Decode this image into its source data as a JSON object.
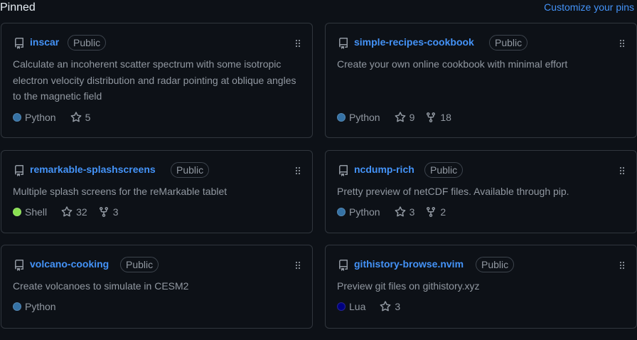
{
  "header": {
    "title": "Pinned",
    "customize_label": "Customize your pins"
  },
  "colors": {
    "python": "#3572A5",
    "shell": "#89e051",
    "lua": "#000080"
  },
  "cards": [
    {
      "name": "inscar",
      "visibility": "Public",
      "description": "Calculate an incoherent scatter spectrum with some isotropic electron velocity distribution and radar pointing at oblique angles to the magnetic field",
      "language": "Python",
      "stars": "5",
      "forks": ""
    },
    {
      "name": "simple-recipes-cookbook",
      "visibility": "Public",
      "description": "Create your own online cookbook with minimal effort",
      "language": "Python",
      "stars": "9",
      "forks": "18"
    },
    {
      "name": "remarkable-splashscreens",
      "visibility": "Public",
      "description": "Multiple splash screens for the reMarkable tablet",
      "language": "Shell",
      "stars": "32",
      "forks": "3"
    },
    {
      "name": "ncdump-rich",
      "visibility": "Public",
      "description": "Pretty preview of netCDF files. Available through pip.",
      "language": "Python",
      "stars": "3",
      "forks": "2"
    },
    {
      "name": "volcano-cooking",
      "visibility": "Public",
      "description": "Create volcanoes to simulate in CESM2",
      "language": "Python",
      "stars": "",
      "forks": ""
    },
    {
      "name": "githistory-browse.nvim",
      "visibility": "Public",
      "description": "Preview git files on githistory.xyz",
      "language": "Lua",
      "stars": "3",
      "forks": ""
    }
  ]
}
